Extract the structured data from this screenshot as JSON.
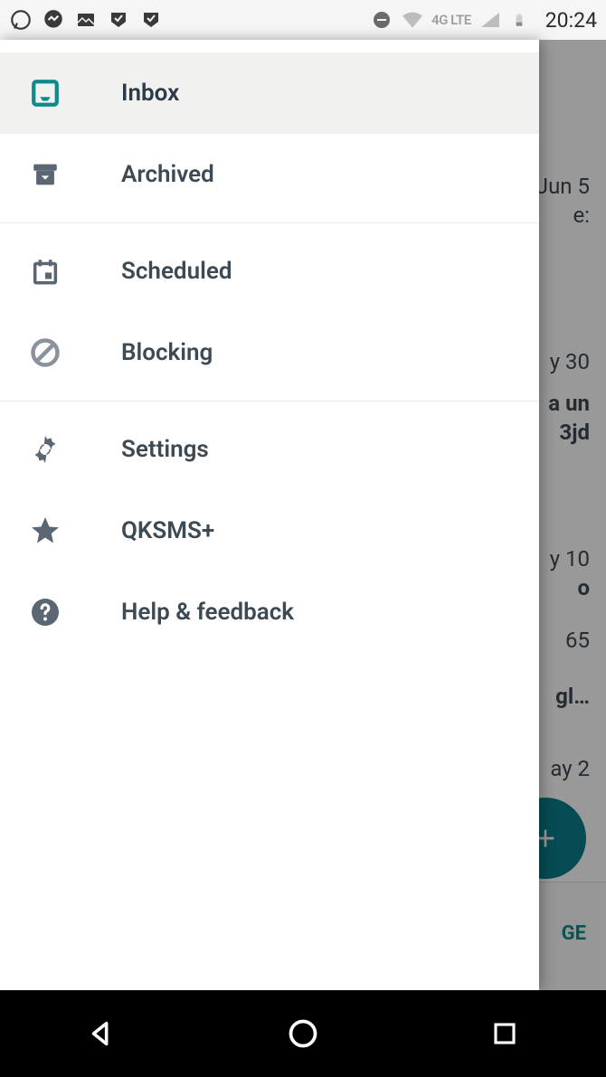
{
  "status": {
    "clock": "20:24",
    "network_label": "4G LTE"
  },
  "drawer": {
    "items": [
      {
        "label": "Inbox",
        "icon": "inbox-icon",
        "active": true
      },
      {
        "label": "Archived",
        "icon": "archive-icon",
        "active": false
      },
      {
        "label": "Scheduled",
        "icon": "calendar-icon",
        "active": false
      },
      {
        "label": "Blocking",
        "icon": "block-icon",
        "active": false
      },
      {
        "label": "Settings",
        "icon": "gear-icon",
        "active": false
      },
      {
        "label": "QKSMS+",
        "icon": "star-icon",
        "active": false
      },
      {
        "label": "Help & feedback",
        "icon": "help-icon",
        "active": false
      }
    ]
  },
  "background_conversations": [
    {
      "date": "Jun 5",
      "snippet": "e:"
    },
    {
      "date": "y 30",
      "snippet": ""
    },
    {
      "date": "",
      "snippet": "a un"
    },
    {
      "date": "",
      "snippet": "3jd"
    },
    {
      "date": "y 10",
      "snippet": "o"
    },
    {
      "date": "65",
      "snippet": ""
    },
    {
      "date": "",
      "snippet": "gl…"
    },
    {
      "date": "ay 2",
      "snippet": ""
    }
  ],
  "footer_link": "GE",
  "colors": {
    "accent": "#0f8a8a",
    "drawer_text": "#3d4a54",
    "fab": "#0a7d8a"
  }
}
